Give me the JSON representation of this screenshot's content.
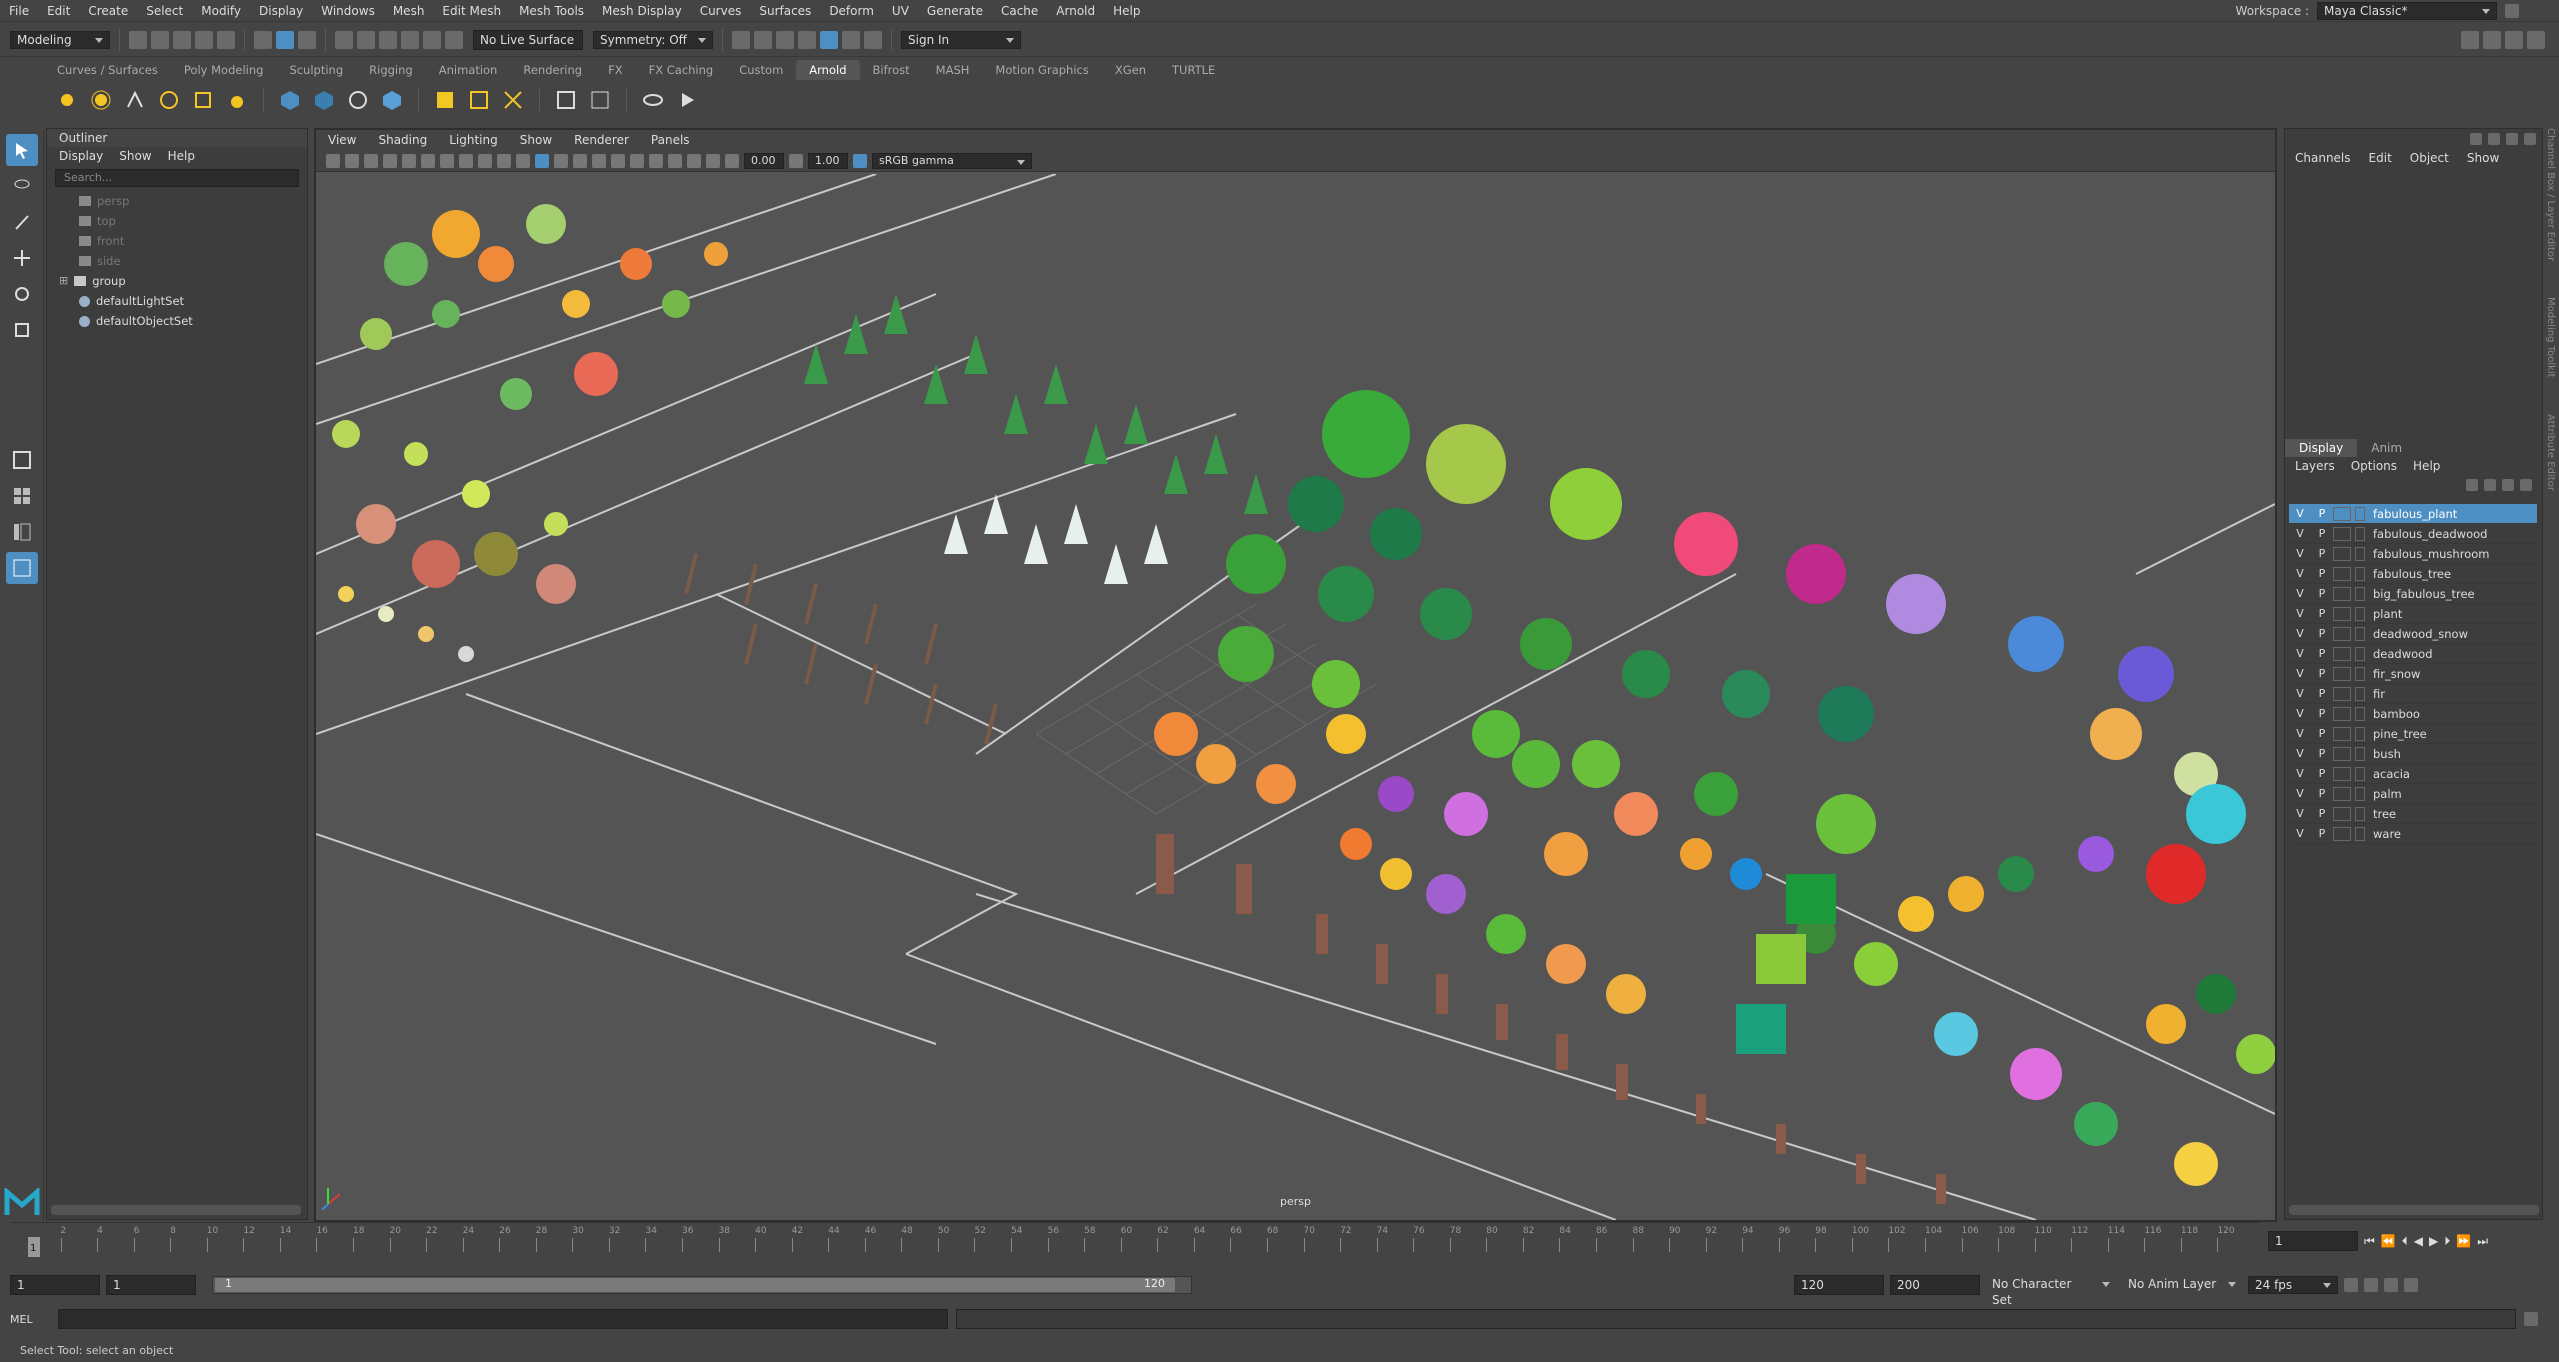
{
  "menubar": {
    "items": [
      "File",
      "Edit",
      "Create",
      "Select",
      "Modify",
      "Display",
      "Windows",
      "Mesh",
      "Edit Mesh",
      "Mesh Tools",
      "Mesh Display",
      "Curves",
      "Surfaces",
      "Deform",
      "UV",
      "Generate",
      "Cache",
      "Arnold",
      "Help"
    ],
    "workspace_label": "Workspace :",
    "workspace_value": "Maya Classic*"
  },
  "status": {
    "mode": "Modeling",
    "live_surface": "No Live Surface",
    "symmetry": "Symmetry: Off",
    "sign_in": "Sign In"
  },
  "shelf_tabs": [
    "Curves / Surfaces",
    "Poly Modeling",
    "Sculpting",
    "Rigging",
    "Animation",
    "Rendering",
    "FX",
    "FX Caching",
    "Custom",
    "Arnold",
    "Bifrost",
    "MASH",
    "Motion Graphics",
    "XGen",
    "TURTLE"
  ],
  "shelf_active": "Arnold",
  "outliner": {
    "title": "Outliner",
    "menu": [
      "Display",
      "Show",
      "Help"
    ],
    "search_placeholder": "Search...",
    "nodes": [
      {
        "label": "persp",
        "dim": true,
        "icon": "camera-icon"
      },
      {
        "label": "top",
        "dim": true,
        "icon": "camera-icon"
      },
      {
        "label": "front",
        "dim": true,
        "icon": "camera-icon"
      },
      {
        "label": "side",
        "dim": true,
        "icon": "camera-icon"
      },
      {
        "label": "group",
        "dim": false,
        "icon": "group-icon"
      },
      {
        "label": "defaultLightSet",
        "dim": false,
        "icon": "set-icon"
      },
      {
        "label": "defaultObjectSet",
        "dim": false,
        "icon": "set-icon"
      }
    ]
  },
  "viewport": {
    "menu": [
      "View",
      "Shading",
      "Lighting",
      "Show",
      "Renderer",
      "Panels"
    ],
    "exposure": "0.00",
    "gamma": "1.00",
    "color_space": "sRGB gamma",
    "camera": "persp"
  },
  "channelbox": {
    "menu": [
      "Channels",
      "Edit",
      "Object",
      "Show"
    ]
  },
  "layers": {
    "tabs": [
      "Display",
      "Anim"
    ],
    "menu": [
      "Layers",
      "Options",
      "Help"
    ],
    "items": [
      {
        "v": "V",
        "p": "P",
        "name": "fabulous_plant"
      },
      {
        "v": "V",
        "p": "P",
        "name": "fabulous_deadwood"
      },
      {
        "v": "V",
        "p": "P",
        "name": "fabulous_mushroom"
      },
      {
        "v": "V",
        "p": "P",
        "name": "fabulous_tree"
      },
      {
        "v": "V",
        "p": "P",
        "name": "big_fabulous_tree"
      },
      {
        "v": "V",
        "p": "P",
        "name": "plant"
      },
      {
        "v": "V",
        "p": "P",
        "name": "deadwood_snow"
      },
      {
        "v": "V",
        "p": "P",
        "name": "deadwood"
      },
      {
        "v": "V",
        "p": "P",
        "name": "fir_snow"
      },
      {
        "v": "V",
        "p": "P",
        "name": "fir"
      },
      {
        "v": "V",
        "p": "P",
        "name": "bamboo"
      },
      {
        "v": "V",
        "p": "P",
        "name": "pine_tree"
      },
      {
        "v": "V",
        "p": "P",
        "name": "bush"
      },
      {
        "v": "V",
        "p": "P",
        "name": "acacia"
      },
      {
        "v": "V",
        "p": "P",
        "name": "palm"
      },
      {
        "v": "V",
        "p": "P",
        "name": "tree"
      },
      {
        "v": "V",
        "p": "P",
        "name": "ware"
      }
    ]
  },
  "side_tabs": [
    "Channel Box / Layer Editor",
    "Modeling Toolkit",
    "Attribute Editor"
  ],
  "timeline": {
    "ticks": [
      "2",
      "4",
      "6",
      "8",
      "10",
      "12",
      "14",
      "16",
      "18",
      "20",
      "22",
      "24",
      "26",
      "28",
      "30",
      "32",
      "34",
      "36",
      "38",
      "40",
      "42",
      "44",
      "46",
      "48",
      "50",
      "52",
      "54",
      "56",
      "58",
      "60",
      "62",
      "64",
      "66",
      "68",
      "70",
      "72",
      "74",
      "76",
      "78",
      "80",
      "82",
      "84",
      "86",
      "88",
      "90",
      "92",
      "94",
      "96",
      "98",
      "100",
      "102",
      "104",
      "106",
      "108",
      "110",
      "112",
      "114",
      "116",
      "118",
      "120"
    ],
    "current_frame": "1",
    "frame_field": "1"
  },
  "range": {
    "start": "1",
    "playback_start": "1",
    "range_start_label": "1",
    "range_end_label": "120",
    "playback_end": "120",
    "end": "200",
    "character_set": "No Character Set",
    "anim_layer": "No Anim Layer",
    "fps": "24 fps"
  },
  "cmdline": {
    "label": "MEL"
  },
  "helpline": {
    "text": "Select Tool: select an object"
  },
  "colors": {
    "accent": "#4d8fc2",
    "panel": "#3d3d3d",
    "viewport": "#545454"
  }
}
